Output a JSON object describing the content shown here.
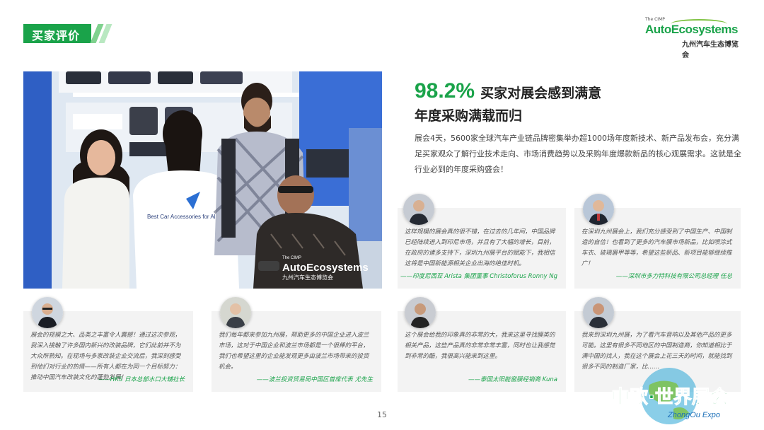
{
  "section_tag": "买家评价",
  "logo": {
    "small": "The CIMP",
    "word": "AutoEcosystems",
    "cn": "九州汽车生态博览会"
  },
  "photo": {
    "shirt_text": "Best Car Accessories for All",
    "overlay_small": "The CIMP",
    "overlay_word": "AutoEcosystems",
    "overlay_cn": "九州汽车生态博览会"
  },
  "headline": {
    "percent": "98.2%",
    "line1": "买家对展会感到满意",
    "line2": "年度采购满载而归"
  },
  "intro": "展会4天，5600家全球汽车产业链品牌密集举办超1000场年度新技术、新产品发布会，充分满足买家观众了解行业技术走向、市场消费趋势以及采购年度爆款新品的核心观展需求。这就是全行业必到的年度采购盛会！",
  "testimonials": [
    {
      "quote": "这样规模的展会真的很不错，在过去的几年间，中国品牌已经陆续进入到印尼市场，并且有了大幅的增长，目前，在政府的诸多支持下，深圳九州展平台的赋能下，我相信这将是中国新能源相关企业出海的绝佳时机。",
      "author": "——印度尼西亚 Arista 集团董事 Christoforus Ronny Ng"
    },
    {
      "quote": "在深圳九州展会上，我们充分感受到了中国生产、中国制造的自信！也看到了更多的汽车膜市场新品，比如喷涂式车衣、玻璃眉甲等等，希望这些新品、新项目能够继续推广！",
      "author": "——深圳市多力特科技有限公司总经理 任总"
    },
    {
      "quote": "展会的规模之大、品类之丰富令人震撼！通过这次参观，我深入接触了许多国内新兴的改装品牌，它们此前并不为大众所熟知。在现场与多家改装企业交流后，我深刻感受到他们对行业的热情——所有人都在为同一个目标努力：推动中国汽车改装文化的蓬勃发展！",
      "author": "——HKS 日本总部水口大辅社长"
    },
    {
      "quote": "我们每年都来参加九州展，帮助更多的中国企业进入波兰市场，这对于中国企业和波兰市场都是一个很棒的平台，我们也希望这里的企业能发现更多由波兰市场带来的投资机会。",
      "author": "——波兰投资贸易局中国区首席代表 尤先生"
    },
    {
      "quote": "这个展会给我的印象真的非常的大，我来这里寻找膜类的相关产品，这些产品真的非常非常丰富，同时也让我感觉到非常的酷，我很高兴能来到这里。",
      "author": "——泰国太阳能窗膜经销商 Kuna"
    },
    {
      "quote": "我来到深圳九州展，为了看汽车音响以及其他产品的更多可能。这里有很多不同地区的中国制造商，你知道相比于满中国的找人，我在这个展会上花三天的时间，就能找到很多不同的制造厂家，比……",
      "author": ""
    }
  ],
  "page_number": "15",
  "watermark": {
    "cn": "中欧·世界展会",
    "en": "ZhongOu Expo"
  },
  "colors": {
    "accent": "#1aa34a",
    "card_bg": "#f3f3f3"
  }
}
